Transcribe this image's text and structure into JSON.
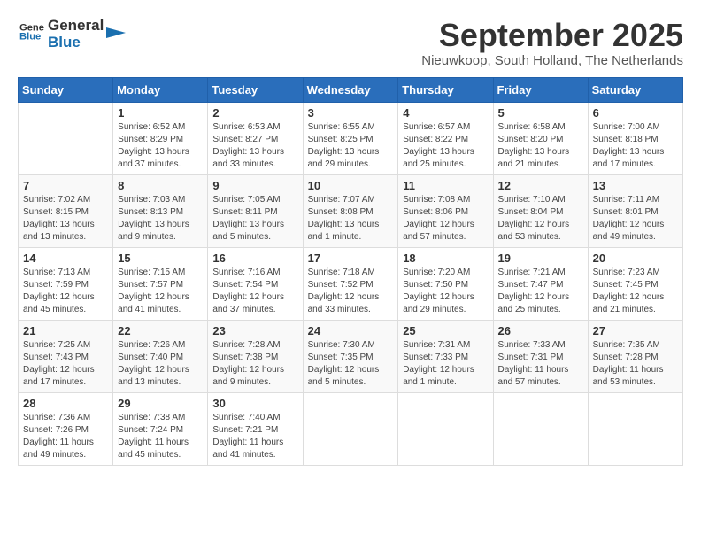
{
  "header": {
    "logo_general": "General",
    "logo_blue": "Blue",
    "month_title": "September 2025",
    "location": "Nieuwkoop, South Holland, The Netherlands"
  },
  "weekdays": [
    "Sunday",
    "Monday",
    "Tuesday",
    "Wednesday",
    "Thursday",
    "Friday",
    "Saturday"
  ],
  "weeks": [
    [
      {
        "day": "",
        "info": ""
      },
      {
        "day": "1",
        "info": "Sunrise: 6:52 AM\nSunset: 8:29 PM\nDaylight: 13 hours\nand 37 minutes."
      },
      {
        "day": "2",
        "info": "Sunrise: 6:53 AM\nSunset: 8:27 PM\nDaylight: 13 hours\nand 33 minutes."
      },
      {
        "day": "3",
        "info": "Sunrise: 6:55 AM\nSunset: 8:25 PM\nDaylight: 13 hours\nand 29 minutes."
      },
      {
        "day": "4",
        "info": "Sunrise: 6:57 AM\nSunset: 8:22 PM\nDaylight: 13 hours\nand 25 minutes."
      },
      {
        "day": "5",
        "info": "Sunrise: 6:58 AM\nSunset: 8:20 PM\nDaylight: 13 hours\nand 21 minutes."
      },
      {
        "day": "6",
        "info": "Sunrise: 7:00 AM\nSunset: 8:18 PM\nDaylight: 13 hours\nand 17 minutes."
      }
    ],
    [
      {
        "day": "7",
        "info": "Sunrise: 7:02 AM\nSunset: 8:15 PM\nDaylight: 13 hours\nand 13 minutes."
      },
      {
        "day": "8",
        "info": "Sunrise: 7:03 AM\nSunset: 8:13 PM\nDaylight: 13 hours\nand 9 minutes."
      },
      {
        "day": "9",
        "info": "Sunrise: 7:05 AM\nSunset: 8:11 PM\nDaylight: 13 hours\nand 5 minutes."
      },
      {
        "day": "10",
        "info": "Sunrise: 7:07 AM\nSunset: 8:08 PM\nDaylight: 13 hours\nand 1 minute."
      },
      {
        "day": "11",
        "info": "Sunrise: 7:08 AM\nSunset: 8:06 PM\nDaylight: 12 hours\nand 57 minutes."
      },
      {
        "day": "12",
        "info": "Sunrise: 7:10 AM\nSunset: 8:04 PM\nDaylight: 12 hours\nand 53 minutes."
      },
      {
        "day": "13",
        "info": "Sunrise: 7:11 AM\nSunset: 8:01 PM\nDaylight: 12 hours\nand 49 minutes."
      }
    ],
    [
      {
        "day": "14",
        "info": "Sunrise: 7:13 AM\nSunset: 7:59 PM\nDaylight: 12 hours\nand 45 minutes."
      },
      {
        "day": "15",
        "info": "Sunrise: 7:15 AM\nSunset: 7:57 PM\nDaylight: 12 hours\nand 41 minutes."
      },
      {
        "day": "16",
        "info": "Sunrise: 7:16 AM\nSunset: 7:54 PM\nDaylight: 12 hours\nand 37 minutes."
      },
      {
        "day": "17",
        "info": "Sunrise: 7:18 AM\nSunset: 7:52 PM\nDaylight: 12 hours\nand 33 minutes."
      },
      {
        "day": "18",
        "info": "Sunrise: 7:20 AM\nSunset: 7:50 PM\nDaylight: 12 hours\nand 29 minutes."
      },
      {
        "day": "19",
        "info": "Sunrise: 7:21 AM\nSunset: 7:47 PM\nDaylight: 12 hours\nand 25 minutes."
      },
      {
        "day": "20",
        "info": "Sunrise: 7:23 AM\nSunset: 7:45 PM\nDaylight: 12 hours\nand 21 minutes."
      }
    ],
    [
      {
        "day": "21",
        "info": "Sunrise: 7:25 AM\nSunset: 7:43 PM\nDaylight: 12 hours\nand 17 minutes."
      },
      {
        "day": "22",
        "info": "Sunrise: 7:26 AM\nSunset: 7:40 PM\nDaylight: 12 hours\nand 13 minutes."
      },
      {
        "day": "23",
        "info": "Sunrise: 7:28 AM\nSunset: 7:38 PM\nDaylight: 12 hours\nand 9 minutes."
      },
      {
        "day": "24",
        "info": "Sunrise: 7:30 AM\nSunset: 7:35 PM\nDaylight: 12 hours\nand 5 minutes."
      },
      {
        "day": "25",
        "info": "Sunrise: 7:31 AM\nSunset: 7:33 PM\nDaylight: 12 hours\nand 1 minute."
      },
      {
        "day": "26",
        "info": "Sunrise: 7:33 AM\nSunset: 7:31 PM\nDaylight: 11 hours\nand 57 minutes."
      },
      {
        "day": "27",
        "info": "Sunrise: 7:35 AM\nSunset: 7:28 PM\nDaylight: 11 hours\nand 53 minutes."
      }
    ],
    [
      {
        "day": "28",
        "info": "Sunrise: 7:36 AM\nSunset: 7:26 PM\nDaylight: 11 hours\nand 49 minutes."
      },
      {
        "day": "29",
        "info": "Sunrise: 7:38 AM\nSunset: 7:24 PM\nDaylight: 11 hours\nand 45 minutes."
      },
      {
        "day": "30",
        "info": "Sunrise: 7:40 AM\nSunset: 7:21 PM\nDaylight: 11 hours\nand 41 minutes."
      },
      {
        "day": "",
        "info": ""
      },
      {
        "day": "",
        "info": ""
      },
      {
        "day": "",
        "info": ""
      },
      {
        "day": "",
        "info": ""
      }
    ]
  ]
}
